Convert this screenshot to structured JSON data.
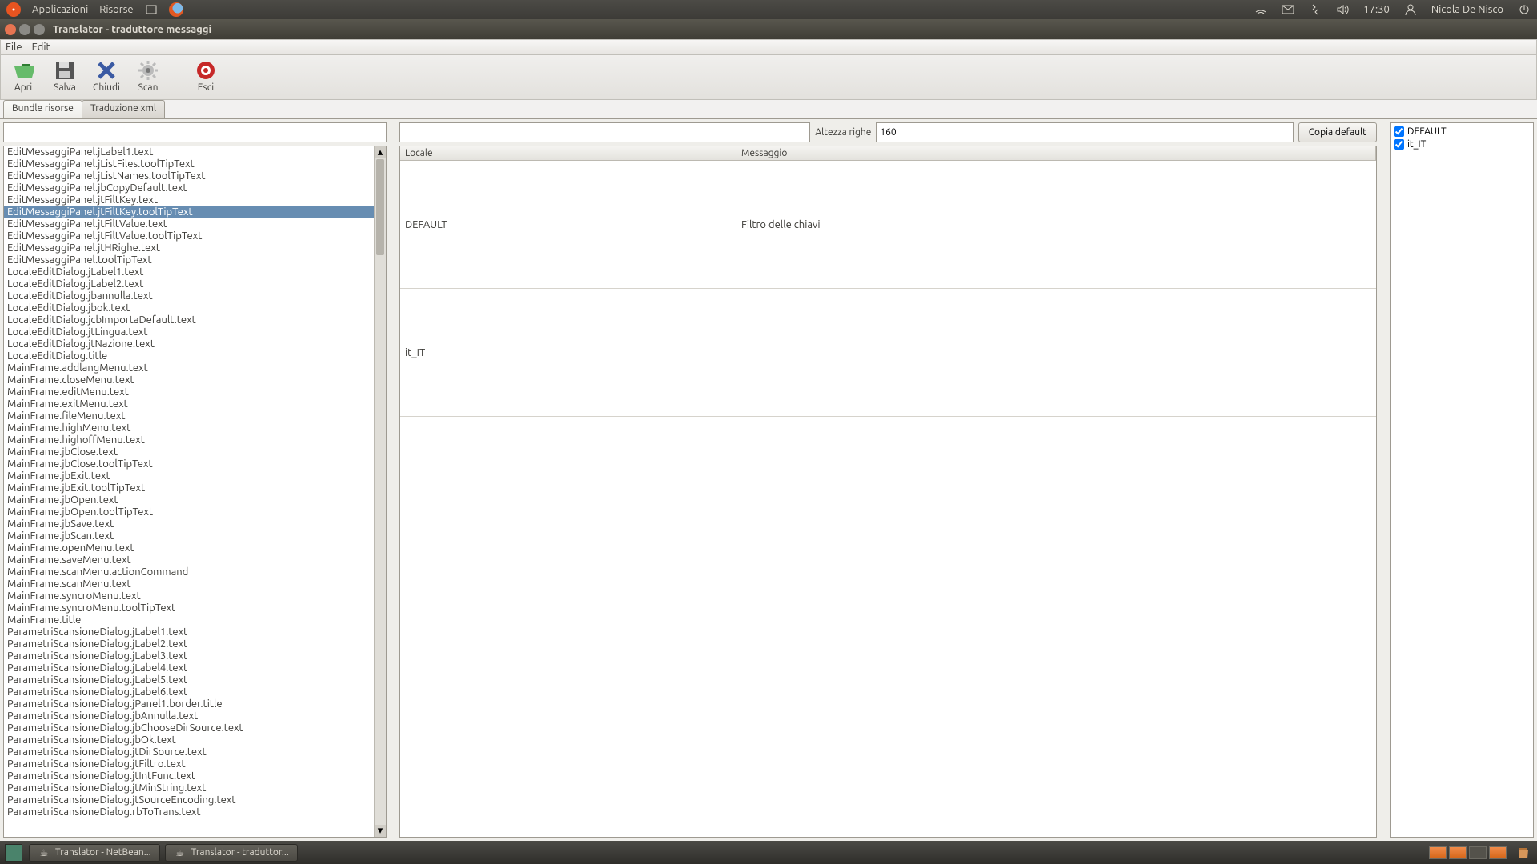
{
  "system_bar": {
    "apps": "Applicazioni",
    "resources": "Risorse",
    "time": "17:30",
    "user": "Nicola De Nisco"
  },
  "window": {
    "title": "Translator - traduttore messaggi"
  },
  "menu": {
    "file": "File",
    "edit": "Edit"
  },
  "toolbar": {
    "open": "Apri",
    "save": "Salva",
    "close": "Chiudi",
    "scan": "Scan",
    "exit": "Esci"
  },
  "tabs": {
    "bundle": "Bundle risorse",
    "xml": "Traduzione xml"
  },
  "key_list": {
    "selected_index": 5,
    "items": [
      "EditMessaggiPanel.jLabel1.text",
      "EditMessaggiPanel.jListFiles.toolTipText",
      "EditMessaggiPanel.jListNames.toolTipText",
      "EditMessaggiPanel.jbCopyDefault.text",
      "EditMessaggiPanel.jtFiltKey.text",
      "EditMessaggiPanel.jtFiltKey.toolTipText",
      "EditMessaggiPanel.jtFiltValue.text",
      "EditMessaggiPanel.jtFiltValue.toolTipText",
      "EditMessaggiPanel.jtHRighe.text",
      "EditMessaggiPanel.toolTipText",
      "LocaleEditDialog.jLabel1.text",
      "LocaleEditDialog.jLabel2.text",
      "LocaleEditDialog.jbannulla.text",
      "LocaleEditDialog.jbok.text",
      "LocaleEditDialog.jcbImportaDefault.text",
      "LocaleEditDialog.jtLingua.text",
      "LocaleEditDialog.jtNazione.text",
      "LocaleEditDialog.title",
      "MainFrame.addlangMenu.text",
      "MainFrame.closeMenu.text",
      "MainFrame.editMenu.text",
      "MainFrame.exitMenu.text",
      "MainFrame.fileMenu.text",
      "MainFrame.highMenu.text",
      "MainFrame.highoffMenu.text",
      "MainFrame.jbClose.text",
      "MainFrame.jbClose.toolTipText",
      "MainFrame.jbExit.text",
      "MainFrame.jbExit.toolTipText",
      "MainFrame.jbOpen.text",
      "MainFrame.jbOpen.toolTipText",
      "MainFrame.jbSave.text",
      "MainFrame.jbScan.text",
      "MainFrame.openMenu.text",
      "MainFrame.saveMenu.text",
      "MainFrame.scanMenu.actionCommand",
      "MainFrame.scanMenu.text",
      "MainFrame.syncroMenu.text",
      "MainFrame.syncroMenu.toolTipText",
      "MainFrame.title",
      "ParametriScansioneDialog.jLabel1.text",
      "ParametriScansioneDialog.jLabel2.text",
      "ParametriScansioneDialog.jLabel3.text",
      "ParametriScansioneDialog.jLabel4.text",
      "ParametriScansioneDialog.jLabel5.text",
      "ParametriScansioneDialog.jLabel6.text",
      "ParametriScansioneDialog.jPanel1.border.title",
      "ParametriScansioneDialog.jbAnnulla.text",
      "ParametriScansioneDialog.jbChooseDirSource.text",
      "ParametriScansioneDialog.jbOk.text",
      "ParametriScansioneDialog.jtDirSource.text",
      "ParametriScansioneDialog.jtFiltro.text",
      "ParametriScansioneDialog.jtIntFunc.text",
      "ParametriScansioneDialog.jtMinString.text",
      "ParametriScansioneDialog.jtSourceEncoding.text",
      "ParametriScansioneDialog.rbToTrans.text"
    ]
  },
  "center": {
    "row_height_label": "Altezza righe",
    "row_height_value": "160",
    "copy_default": "Copia default",
    "columns": {
      "locale": "Locale",
      "message": "Messaggio"
    },
    "rows": [
      {
        "locale": "DEFAULT",
        "message": "Filtro delle chiavi"
      },
      {
        "locale": "it_IT",
        "message": ""
      }
    ]
  },
  "locales": {
    "items": [
      {
        "name": "DEFAULT",
        "checked": true
      },
      {
        "name": "it_IT",
        "checked": true
      }
    ]
  },
  "taskbar": {
    "t1": "Translator - NetBean...",
    "t2": "Translator - traduttor..."
  }
}
